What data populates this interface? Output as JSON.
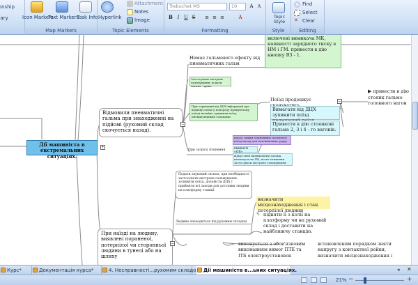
{
  "ribbon": {
    "relationship_label": "Relationship",
    "boundary_label": "Boundary",
    "icon_markers_label": "Icon Markers",
    "text_markers_label": "Text Markers",
    "task_info_label": "Task Info",
    "map_markers_caption": "Map Markers",
    "hyperlink_label": "Hyperlink",
    "attachment_label": "Attachment",
    "notes_label": "Notes",
    "image_label": "Image",
    "topic_elements_caption": "Topic Elements",
    "font_name": "Trebuchet MS",
    "font_size": "10",
    "formatting_caption": "Formatting",
    "topic_style_label": "Topic Style",
    "style_caption": "Style",
    "find_label": "Find",
    "select_label": "Select",
    "clear_label": "Clear",
    "editing_caption": "Editing"
  },
  "map": {
    "central_topic": "Дії машиніста в екстремальних ситуаціях.",
    "topic_brakes": "Відмовили пневматичні гальма при знаходженні на підйомі (рухомий склад скочується назад).",
    "topic_person": "При наїзді на людину, виявлені пораненої, потерпілої чи сторонньої людини в тунелі або на шляху",
    "node_no_brake_effect": "Немає гальмового ефекту від пневматичних гальм",
    "node_top_green": "включені вимикача МК, наявності зарядного тиску в НМ і ГМ. привести в дію кнопку ВЗ - 1.",
    "node_emergency_brake": "Застосувати екстрене гальмування, подати сигнал  - крик.",
    "node_dcp_info": "При отриманні від ДЦХ інформації про відмову гальм у попереду прямуючому поїзді негайно зупинити поїзд пневматичними гальмами",
    "node_train_continues": "Поїзд продовжує скочуватись",
    "node_activate_far": "привести в дію стоянк гальмо головного вагон",
    "node_demand_dcp": "Вимагати від ДЦХ зупинити поїзд прямуючий поїзд.",
    "node_activate_parking": "Привести в дію стоянкові гальма 2, 3 і 4 - го вагонів.",
    "node_threat": "При загрозі зіткнення",
    "node_before_collision": "перед самим зіткненням скотитися поїзд назад для пом'якшення удару",
    "node_button_ob": "вимкати «ОБ»",
    "node_release_brakes": "відпустити пневматичні гальма, натиснути на ПБ, після зіткнення застосувати екстрене гальмування.",
    "node_signal_sound": "Подати звуковий сигнал, при необхідності застосувати екстрене гальмування, зупинити поїзд, доповісти ДЦХ і прийняти всі заходи для доставки людини на платформу станції.",
    "node_person_under": "Людина знаходиться під рухомим складом",
    "node_locate": "визначити місцезнаходження і стан потерпілої людини",
    "node_lift": "підняти її з колії на платформу чи на рухомий склад і доставити на найближчу станцію.",
    "node_perform": "виконується з обов'язковим виконанням вимог ПТЕ та ІТБ електроустановок",
    "node_establish": "встановленим порядком зняти напругу з контактної рейки, визначити місцезнаходження і"
  },
  "tabs": [
    {
      "label": "Курс*"
    },
    {
      "label": "Документація курса*"
    },
    {
      "label": "4. Несправності...рухомим складом"
    },
    {
      "label": "Дії машиніста в...ьних ситуаціях."
    }
  ],
  "status": {
    "zoom": "21%"
  },
  "colors": {
    "central_fill": "#6fc0ea",
    "central_border": "#2e79ad",
    "green_node": "#d3f5cf",
    "cyan_node": "#d6f7fb",
    "purple_node": "#cdb6f0",
    "yellow_highlight": "#fdf3a6",
    "branch_line": "#8a8a8a"
  }
}
